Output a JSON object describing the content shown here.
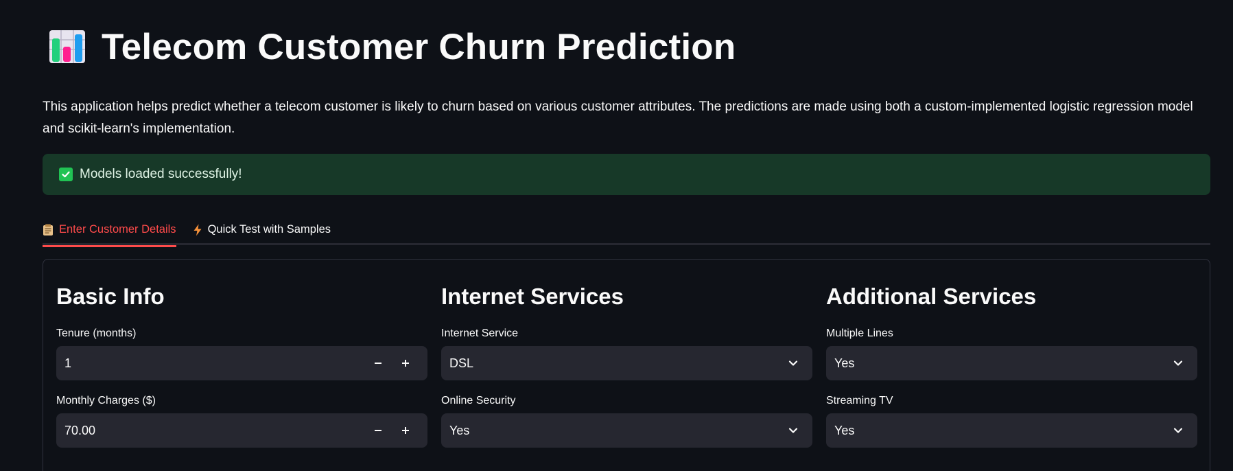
{
  "header": {
    "title": "Telecom Customer Churn Prediction",
    "icon": "bar-chart-icon"
  },
  "description": "This application helps predict whether a telecom customer is likely to churn based on various customer attributes. The predictions are made using both a custom-implemented logistic regression model and scikit-learn's implementation.",
  "alert": {
    "text": "Models loaded successfully!",
    "icon": "check-icon",
    "color": "#173928"
  },
  "tabs": [
    {
      "label": "Enter Customer Details",
      "icon": "clipboard-icon",
      "active": true
    },
    {
      "label": "Quick Test with Samples",
      "icon": "lightning-icon",
      "active": false
    }
  ],
  "accent_color": "#ff4b4b",
  "form": {
    "basic": {
      "heading": "Basic Info",
      "tenure": {
        "label": "Tenure (months)",
        "value": "1"
      },
      "monthly": {
        "label": "Monthly Charges ($)",
        "value": "70.00"
      }
    },
    "internet": {
      "heading": "Internet Services",
      "service": {
        "label": "Internet Service",
        "value": "DSL"
      },
      "security": {
        "label": "Online Security",
        "value": "Yes"
      }
    },
    "additional": {
      "heading": "Additional Services",
      "lines": {
        "label": "Multiple Lines",
        "value": "Yes"
      },
      "tv": {
        "label": "Streaming TV",
        "value": "Yes"
      }
    }
  },
  "stepper": {
    "minus": "−",
    "plus": "+"
  }
}
